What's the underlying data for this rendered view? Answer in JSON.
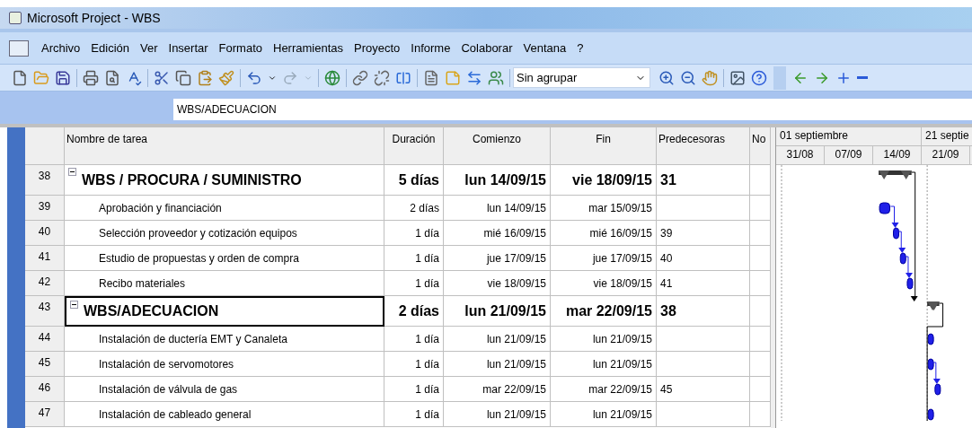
{
  "window": {
    "title": "Microsoft Project - WBS"
  },
  "menu": [
    {
      "label": "Archivo"
    },
    {
      "label": "Edición"
    },
    {
      "label": "Ver"
    },
    {
      "label": "Insertar"
    },
    {
      "label": "Formato"
    },
    {
      "label": "Herramientas"
    },
    {
      "label": "Proyecto"
    },
    {
      "label": "Informe"
    },
    {
      "label": "Colaborar"
    },
    {
      "label": "Ventana"
    },
    {
      "label": "?"
    }
  ],
  "toolbar": {
    "group_select": {
      "value": "Sin agrupar"
    }
  },
  "entry_bar": {
    "value": "WBS/ADECUACION"
  },
  "table": {
    "columns": [
      "Nombre de tarea",
      "Duración",
      "Comienzo",
      "Fin",
      "Predecesoras",
      "No"
    ],
    "rows": [
      {
        "id": "38",
        "kind": "summary",
        "expanded": true,
        "selected": false,
        "name": "WBS / PROCURA / SUMINISTRO",
        "duration": "5 días",
        "start": "lun 14/09/15",
        "finish": "vie 18/09/15",
        "predecessors": "31"
      },
      {
        "id": "39",
        "kind": "task",
        "selected": false,
        "name": "Aprobación y financiación",
        "duration": "2 días",
        "start": "lun 14/09/15",
        "finish": "mar 15/09/15",
        "predecessors": ""
      },
      {
        "id": "40",
        "kind": "task",
        "selected": false,
        "name": "Selección proveedor y cotización equipos",
        "duration": "1 día",
        "start": "mié 16/09/15",
        "finish": "mié 16/09/15",
        "predecessors": "39"
      },
      {
        "id": "41",
        "kind": "task",
        "selected": false,
        "name": "Estudio de propuestas y orden de compra",
        "duration": "1 día",
        "start": "jue 17/09/15",
        "finish": "jue 17/09/15",
        "predecessors": "40"
      },
      {
        "id": "42",
        "kind": "task",
        "selected": false,
        "name": "Recibo materiales",
        "duration": "1 día",
        "start": "vie 18/09/15",
        "finish": "vie 18/09/15",
        "predecessors": "41"
      },
      {
        "id": "43",
        "kind": "summary",
        "expanded": true,
        "selected": true,
        "name": "WBS/ADECUACION",
        "duration": "2 días",
        "start": "lun 21/09/15",
        "finish": "mar 22/09/15",
        "predecessors": "38"
      },
      {
        "id": "44",
        "kind": "task",
        "selected": false,
        "name": "Instalación de ductería EMT y Canaleta",
        "duration": "1 día",
        "start": "lun 21/09/15",
        "finish": "lun 21/09/15",
        "predecessors": ""
      },
      {
        "id": "45",
        "kind": "task",
        "selected": false,
        "name": "Instalación de servomotores",
        "duration": "1 día",
        "start": "lun 21/09/15",
        "finish": "lun 21/09/15",
        "predecessors": ""
      },
      {
        "id": "46",
        "kind": "task",
        "selected": false,
        "name": "Instalación de válvula de gas",
        "duration": "1 día",
        "start": "mar 22/09/15",
        "finish": "mar 22/09/15",
        "predecessors": "45"
      },
      {
        "id": "47",
        "kind": "task",
        "selected": false,
        "name": "Instalación de cableado general",
        "duration": "1 día",
        "start": "lun 21/09/15",
        "finish": "lun 21/09/15",
        "predecessors": ""
      }
    ]
  },
  "timescale": {
    "months": [
      "01 septiembre",
      "21 septie"
    ],
    "weeks": [
      "31/08",
      "07/09",
      "14/09",
      "21/09"
    ]
  }
}
